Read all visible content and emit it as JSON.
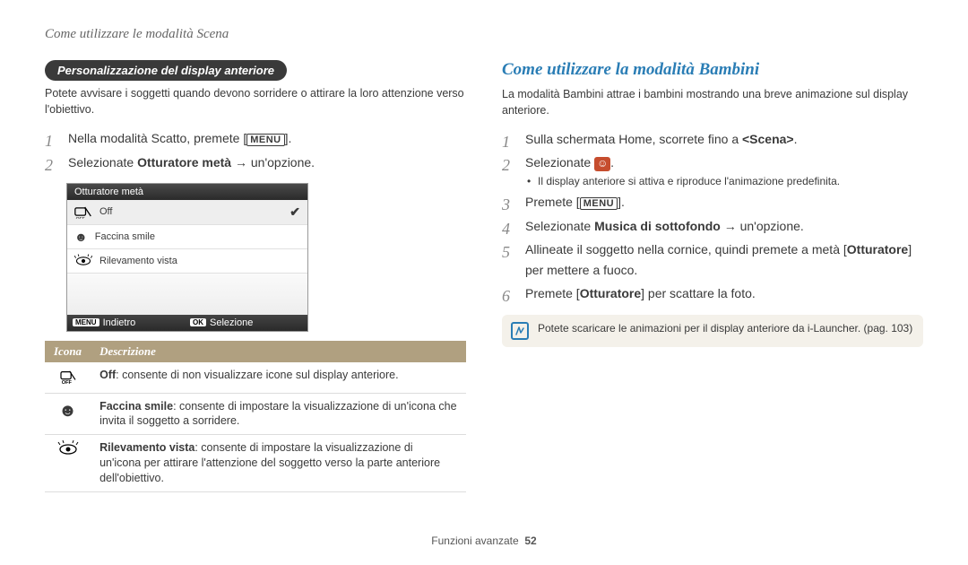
{
  "header": "Come utilizzare le modalità Scena",
  "left": {
    "pill": "Personalizzazione del display anteriore",
    "intro": "Potete avvisare i soggetti quando devono sorridere o attirare la loro attenzione verso l'obiettivo.",
    "step1_a": "Nella modalità Scatto, premete [",
    "step1_menu": "MENU",
    "step1_b": "].",
    "step2_a": "Selezionate ",
    "step2_bold": "Otturatore metà",
    "step2_b": " → un'opzione.",
    "menu": {
      "title": "Otturatore metà",
      "row1": "Off",
      "row2": "Faccina smile",
      "row3": "Rilevamento vista",
      "foot_left_key": "MENU",
      "foot_left": "Indietro",
      "foot_right_key": "OK",
      "foot_right": "Selezione"
    },
    "table": {
      "h1": "Icona",
      "h2": "Descrizione",
      "r1": "Off: consente di non visualizzare icone sul display anteriore.",
      "r1_bold": "Off",
      "r2": ": consente di impostare la visualizzazione di un'icona che invita il soggetto a sorridere.",
      "r2_bold": "Faccina smile",
      "r3": ": consente di impostare la visualizzazione di un'icona per attirare l'attenzione del soggetto verso la parte anteriore dell'obiettivo.",
      "r3_bold": "Rilevamento vista"
    }
  },
  "right": {
    "title": "Come utilizzare la modalità Bambini",
    "intro": "La modalità Bambini attrae i bambini mostrando una breve animazione sul display anteriore.",
    "step1_a": "Sulla schermata Home, scorrete fino a ",
    "step1_bold": "<Scena>",
    "step1_b": ".",
    "step2_a": "Selezionate ",
    "step2_b": ".",
    "step2_sub": "Il display anteriore si attiva e riproduce l'animazione predefinita.",
    "step3_a": "Premete [",
    "step3_menu": "MENU",
    "step3_b": "].",
    "step4_a": "Selezionate ",
    "step4_bold": "Musica di sottofondo",
    "step4_b": " → un'opzione.",
    "step5_a": "Allineate il soggetto nella cornice, quindi premete a metà [",
    "step5_bold": "Otturatore",
    "step5_b": "] per mettere a fuoco.",
    "step6_a": "Premete [",
    "step6_bold": "Otturatore",
    "step6_b": "] per scattare la foto.",
    "info": "Potete scaricare le animazioni per il display anteriore da i-Launcher. (pag. 103)"
  },
  "footer": {
    "label": "Funzioni avanzate",
    "page": "52"
  }
}
